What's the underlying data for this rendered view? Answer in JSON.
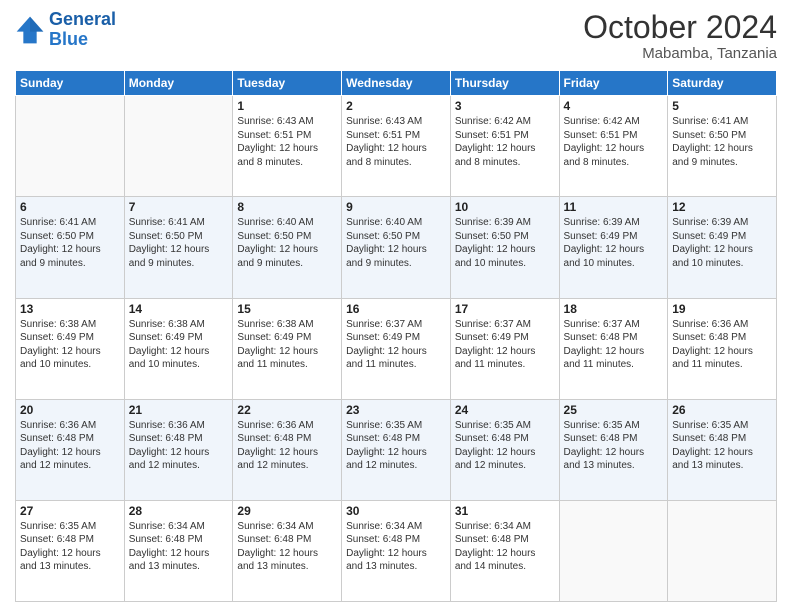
{
  "header": {
    "logo_line1": "General",
    "logo_line2": "Blue",
    "month": "October 2024",
    "location": "Mabamba, Tanzania"
  },
  "weekdays": [
    "Sunday",
    "Monday",
    "Tuesday",
    "Wednesday",
    "Thursday",
    "Friday",
    "Saturday"
  ],
  "weeks": [
    [
      {
        "day": "",
        "sunrise": "",
        "sunset": "",
        "daylight": ""
      },
      {
        "day": "",
        "sunrise": "",
        "sunset": "",
        "daylight": ""
      },
      {
        "day": "1",
        "sunrise": "Sunrise: 6:43 AM",
        "sunset": "Sunset: 6:51 PM",
        "daylight": "Daylight: 12 hours and 8 minutes."
      },
      {
        "day": "2",
        "sunrise": "Sunrise: 6:43 AM",
        "sunset": "Sunset: 6:51 PM",
        "daylight": "Daylight: 12 hours and 8 minutes."
      },
      {
        "day": "3",
        "sunrise": "Sunrise: 6:42 AM",
        "sunset": "Sunset: 6:51 PM",
        "daylight": "Daylight: 12 hours and 8 minutes."
      },
      {
        "day": "4",
        "sunrise": "Sunrise: 6:42 AM",
        "sunset": "Sunset: 6:51 PM",
        "daylight": "Daylight: 12 hours and 8 minutes."
      },
      {
        "day": "5",
        "sunrise": "Sunrise: 6:41 AM",
        "sunset": "Sunset: 6:50 PM",
        "daylight": "Daylight: 12 hours and 9 minutes."
      }
    ],
    [
      {
        "day": "6",
        "sunrise": "Sunrise: 6:41 AM",
        "sunset": "Sunset: 6:50 PM",
        "daylight": "Daylight: 12 hours and 9 minutes."
      },
      {
        "day": "7",
        "sunrise": "Sunrise: 6:41 AM",
        "sunset": "Sunset: 6:50 PM",
        "daylight": "Daylight: 12 hours and 9 minutes."
      },
      {
        "day": "8",
        "sunrise": "Sunrise: 6:40 AM",
        "sunset": "Sunset: 6:50 PM",
        "daylight": "Daylight: 12 hours and 9 minutes."
      },
      {
        "day": "9",
        "sunrise": "Sunrise: 6:40 AM",
        "sunset": "Sunset: 6:50 PM",
        "daylight": "Daylight: 12 hours and 9 minutes."
      },
      {
        "day": "10",
        "sunrise": "Sunrise: 6:39 AM",
        "sunset": "Sunset: 6:50 PM",
        "daylight": "Daylight: 12 hours and 10 minutes."
      },
      {
        "day": "11",
        "sunrise": "Sunrise: 6:39 AM",
        "sunset": "Sunset: 6:49 PM",
        "daylight": "Daylight: 12 hours and 10 minutes."
      },
      {
        "day": "12",
        "sunrise": "Sunrise: 6:39 AM",
        "sunset": "Sunset: 6:49 PM",
        "daylight": "Daylight: 12 hours and 10 minutes."
      }
    ],
    [
      {
        "day": "13",
        "sunrise": "Sunrise: 6:38 AM",
        "sunset": "Sunset: 6:49 PM",
        "daylight": "Daylight: 12 hours and 10 minutes."
      },
      {
        "day": "14",
        "sunrise": "Sunrise: 6:38 AM",
        "sunset": "Sunset: 6:49 PM",
        "daylight": "Daylight: 12 hours and 10 minutes."
      },
      {
        "day": "15",
        "sunrise": "Sunrise: 6:38 AM",
        "sunset": "Sunset: 6:49 PM",
        "daylight": "Daylight: 12 hours and 11 minutes."
      },
      {
        "day": "16",
        "sunrise": "Sunrise: 6:37 AM",
        "sunset": "Sunset: 6:49 PM",
        "daylight": "Daylight: 12 hours and 11 minutes."
      },
      {
        "day": "17",
        "sunrise": "Sunrise: 6:37 AM",
        "sunset": "Sunset: 6:49 PM",
        "daylight": "Daylight: 12 hours and 11 minutes."
      },
      {
        "day": "18",
        "sunrise": "Sunrise: 6:37 AM",
        "sunset": "Sunset: 6:48 PM",
        "daylight": "Daylight: 12 hours and 11 minutes."
      },
      {
        "day": "19",
        "sunrise": "Sunrise: 6:36 AM",
        "sunset": "Sunset: 6:48 PM",
        "daylight": "Daylight: 12 hours and 11 minutes."
      }
    ],
    [
      {
        "day": "20",
        "sunrise": "Sunrise: 6:36 AM",
        "sunset": "Sunset: 6:48 PM",
        "daylight": "Daylight: 12 hours and 12 minutes."
      },
      {
        "day": "21",
        "sunrise": "Sunrise: 6:36 AM",
        "sunset": "Sunset: 6:48 PM",
        "daylight": "Daylight: 12 hours and 12 minutes."
      },
      {
        "day": "22",
        "sunrise": "Sunrise: 6:36 AM",
        "sunset": "Sunset: 6:48 PM",
        "daylight": "Daylight: 12 hours and 12 minutes."
      },
      {
        "day": "23",
        "sunrise": "Sunrise: 6:35 AM",
        "sunset": "Sunset: 6:48 PM",
        "daylight": "Daylight: 12 hours and 12 minutes."
      },
      {
        "day": "24",
        "sunrise": "Sunrise: 6:35 AM",
        "sunset": "Sunset: 6:48 PM",
        "daylight": "Daylight: 12 hours and 12 minutes."
      },
      {
        "day": "25",
        "sunrise": "Sunrise: 6:35 AM",
        "sunset": "Sunset: 6:48 PM",
        "daylight": "Daylight: 12 hours and 13 minutes."
      },
      {
        "day": "26",
        "sunrise": "Sunrise: 6:35 AM",
        "sunset": "Sunset: 6:48 PM",
        "daylight": "Daylight: 12 hours and 13 minutes."
      }
    ],
    [
      {
        "day": "27",
        "sunrise": "Sunrise: 6:35 AM",
        "sunset": "Sunset: 6:48 PM",
        "daylight": "Daylight: 12 hours and 13 minutes."
      },
      {
        "day": "28",
        "sunrise": "Sunrise: 6:34 AM",
        "sunset": "Sunset: 6:48 PM",
        "daylight": "Daylight: 12 hours and 13 minutes."
      },
      {
        "day": "29",
        "sunrise": "Sunrise: 6:34 AM",
        "sunset": "Sunset: 6:48 PM",
        "daylight": "Daylight: 12 hours and 13 minutes."
      },
      {
        "day": "30",
        "sunrise": "Sunrise: 6:34 AM",
        "sunset": "Sunset: 6:48 PM",
        "daylight": "Daylight: 12 hours and 13 minutes."
      },
      {
        "day": "31",
        "sunrise": "Sunrise: 6:34 AM",
        "sunset": "Sunset: 6:48 PM",
        "daylight": "Daylight: 12 hours and 14 minutes."
      },
      {
        "day": "",
        "sunrise": "",
        "sunset": "",
        "daylight": ""
      },
      {
        "day": "",
        "sunrise": "",
        "sunset": "",
        "daylight": ""
      }
    ]
  ]
}
